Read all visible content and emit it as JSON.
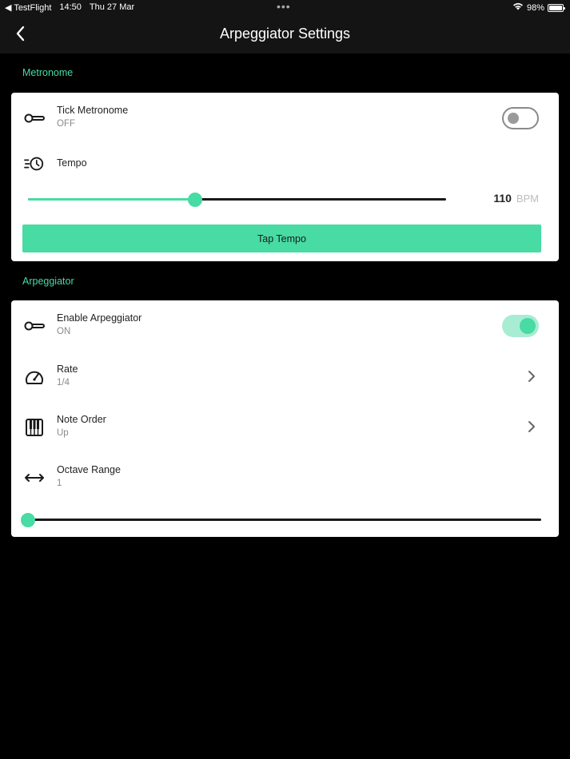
{
  "status_bar": {
    "back_app": "◀ TestFlight",
    "time": "14:50",
    "date": "Thu 27 Mar",
    "battery": "98%",
    "battery_level": 0.98
  },
  "header": {
    "title": "Arpeggiator Settings",
    "back_icon": "chevron-left-icon"
  },
  "metronome": {
    "section_title": "Metronome",
    "tick": {
      "label": "Tick Metronome",
      "value": "OFF",
      "enabled": false,
      "icon": "toggle-key-icon"
    },
    "tempo": {
      "label": "Tempo",
      "icon": "tempo-clock-icon",
      "value": "110",
      "unit": "BPM",
      "slider_fraction": 0.4
    },
    "tap_tempo_label": "Tap Tempo"
  },
  "arpeggiator": {
    "section_title": "Arpeggiator",
    "enable": {
      "label": "Enable Arpeggiator",
      "value": "ON",
      "enabled": true,
      "icon": "toggle-key-icon"
    },
    "rate": {
      "label": "Rate",
      "value": "1/4",
      "icon": "gauge-icon"
    },
    "note_order": {
      "label": "Note Order",
      "value": "Up",
      "icon": "piano-keys-icon"
    },
    "octave_range": {
      "label": "Octave Range",
      "value": "1",
      "icon": "double-arrow-icon",
      "slider_fraction": 0.0
    }
  },
  "colors": {
    "accent": "#48dba4",
    "background": "#000000",
    "card": "#ffffff",
    "header": "#141414"
  }
}
